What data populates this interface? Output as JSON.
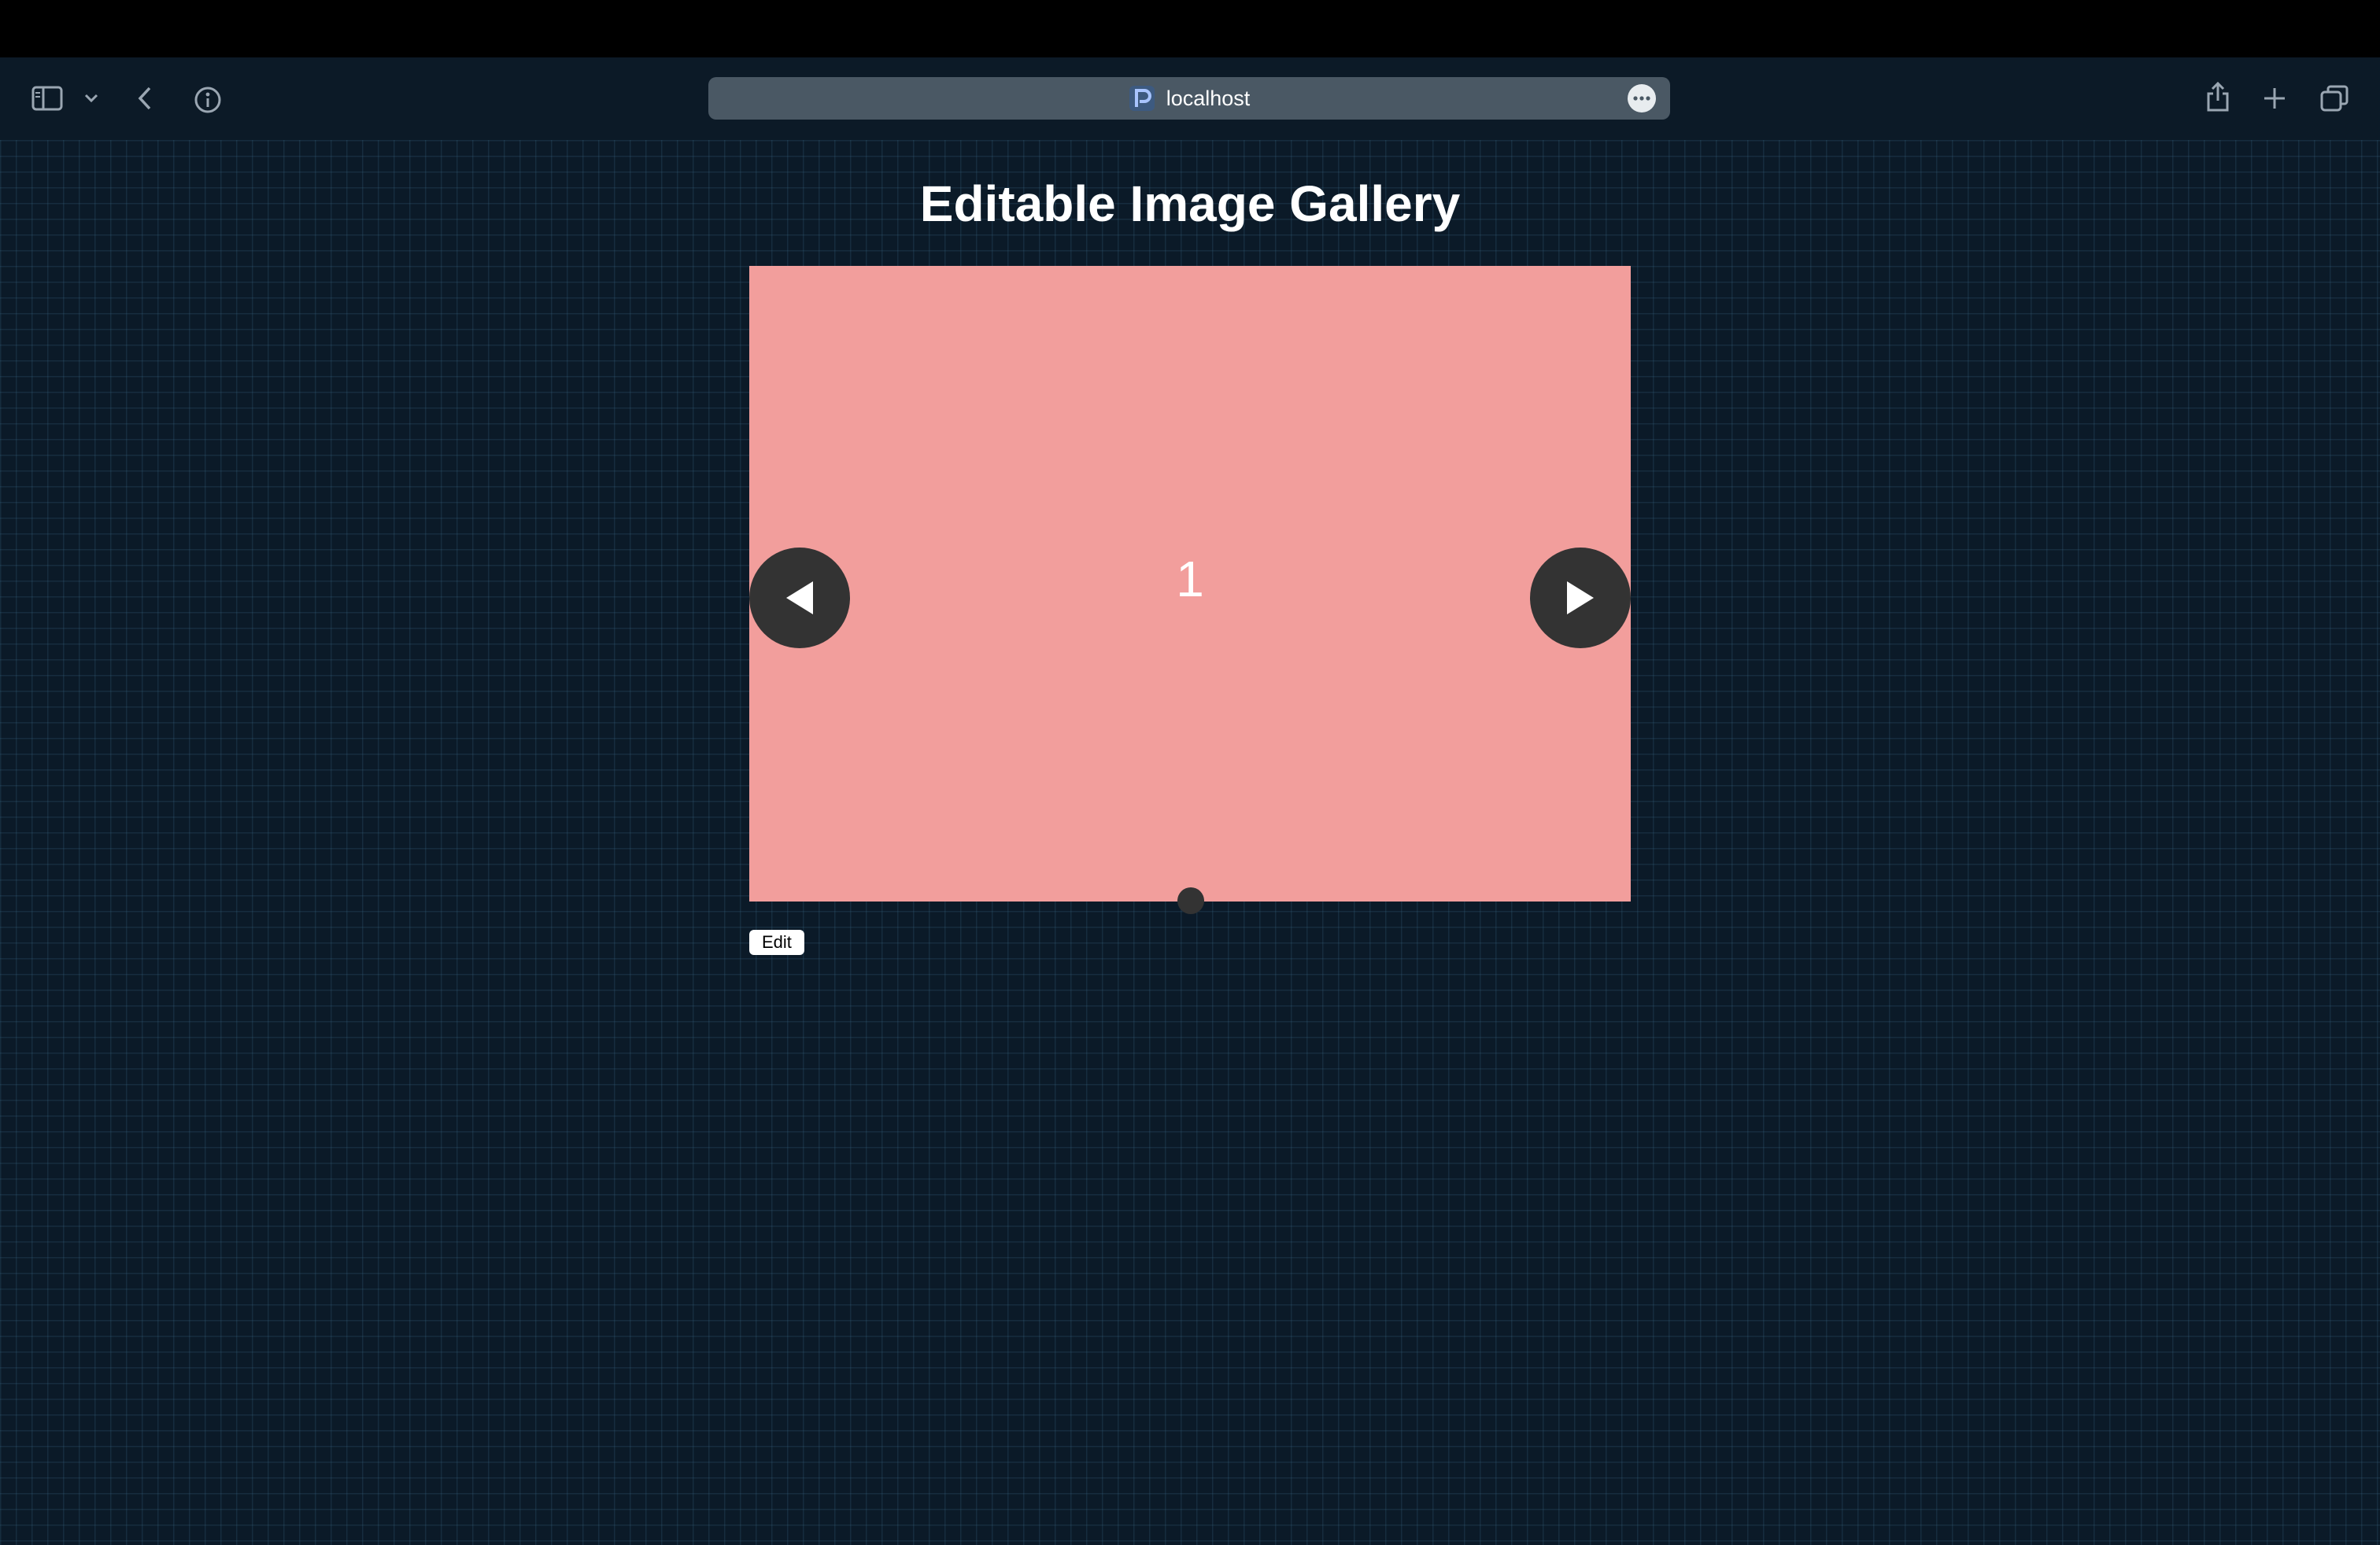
{
  "browser": {
    "url": "localhost",
    "icons": [
      "sidebar-icon",
      "chevron-down-icon",
      "back-icon",
      "info-icon",
      "site-icon",
      "more-icon",
      "share-icon",
      "plus-icon",
      "tabs-icon"
    ]
  },
  "page": {
    "title": "Editable Image Gallery",
    "background_color": "#0b1a28"
  },
  "gallery": {
    "current_slide_label": "1",
    "current_slide_color": "#f29e9c",
    "prev_icon": "triangle-left-icon",
    "next_icon": "triangle-right-icon",
    "control_color": "#333333"
  },
  "actions": {
    "edit_label": "Edit"
  }
}
